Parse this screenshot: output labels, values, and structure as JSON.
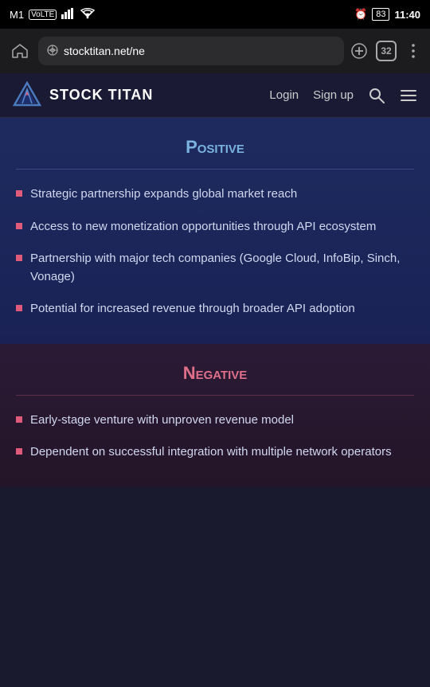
{
  "statusBar": {
    "carrier": "M1",
    "carrierType": "VoLTE",
    "signal": "▐▐▐",
    "wifi": "wifi",
    "time": "11:40",
    "battery": "83",
    "alarmIcon": "⏰"
  },
  "browserBar": {
    "homeIcon": "⌂",
    "urlIcon": "⊙",
    "url": "stocktitan.net/ne",
    "addTabIcon": "+",
    "tabCount": "32",
    "moreIcon": "⋮"
  },
  "navBar": {
    "logoText": "STOCK TITAN",
    "loginLabel": "Login",
    "signupLabel": "Sign up",
    "searchIcon": "🔍",
    "menuIcon": "☰"
  },
  "positive": {
    "title": "Positive",
    "bullets": [
      "Strategic partnership expands global market reach",
      "Access to new monetization opportunities through API ecosystem",
      "Partnership with major tech companies (Google Cloud, InfoBip, Sinch, Vonage)",
      "Potential for increased revenue through broader API adoption"
    ]
  },
  "negative": {
    "title": "Negative",
    "bullets": [
      "Early-stage venture with unproven revenue model",
      "Dependent on successful integration with multiple network operators"
    ]
  }
}
